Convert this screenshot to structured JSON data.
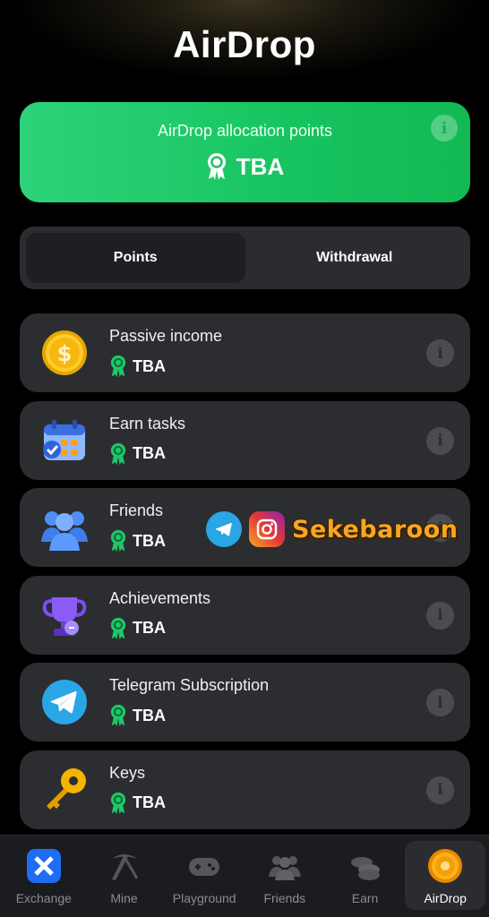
{
  "header": {
    "title": "AirDrop"
  },
  "allocation": {
    "label": "AirDrop allocation points",
    "value": "TBA"
  },
  "segment": {
    "tabs": [
      {
        "label": "Points",
        "active": true
      },
      {
        "label": "Withdrawal",
        "active": false
      }
    ]
  },
  "rows": [
    {
      "title": "Passive income",
      "value": "TBA",
      "icon": "coin-dollar-icon"
    },
    {
      "title": "Earn tasks",
      "value": "TBA",
      "icon": "calendar-icon"
    },
    {
      "title": "Friends",
      "value": "TBA",
      "icon": "friends-icon"
    },
    {
      "title": "Achievements",
      "value": "TBA",
      "icon": "trophy-icon"
    },
    {
      "title": "Telegram Subscription",
      "value": "TBA",
      "icon": "telegram-icon"
    },
    {
      "title": "Keys",
      "value": "TBA",
      "icon": "key-icon"
    }
  ],
  "watermark": {
    "text": "Sekebaroon"
  },
  "tabbar": {
    "items": [
      {
        "label": "Exchange",
        "icon": "exchange-icon"
      },
      {
        "label": "Mine",
        "icon": "pickaxe-icon"
      },
      {
        "label": "Playground",
        "icon": "gamepad-icon"
      },
      {
        "label": "Friends",
        "icon": "friends-icon"
      },
      {
        "label": "Earn",
        "icon": "coins-icon"
      },
      {
        "label": "AirDrop",
        "icon": "airdrop-coin-icon",
        "active": true
      }
    ]
  },
  "colors": {
    "accent_green": "#1fc868",
    "background": "#000000",
    "card": "#2b2d31",
    "info_gray": "#4a4c50"
  }
}
